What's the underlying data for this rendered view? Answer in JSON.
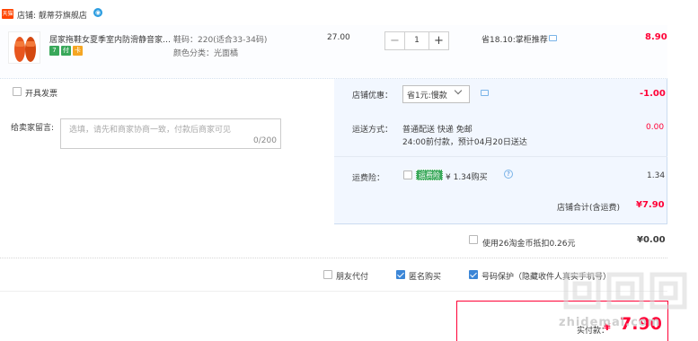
{
  "shop": {
    "tag": "天猫",
    "name": "店铺: 靓蒂芬旗舰店",
    "chat_icon": "wangwang-icon"
  },
  "item": {
    "title": "居家拖鞋女夏季室内防滑静音家…",
    "badges": [
      {
        "label": "7",
        "color": "#39a85a"
      },
      {
        "label": "付",
        "color": "#39a85a"
      },
      {
        "label": "卡",
        "color": "#f5a623"
      }
    ],
    "sku_size": "鞋码：220(适合33-34码)",
    "sku_color": "颜色分类：光面橘",
    "unit_price": "27.00",
    "quantity": "1",
    "saving": "省18.10:掌柜推荐",
    "subtotal": "8.90",
    "thumb_color": "#e8561e"
  },
  "invoice": {
    "label": "开具发票"
  },
  "message": {
    "label": "给卖家留言:",
    "placeholder": "选填，请先和商家协商一致，付款后商家可见",
    "counter": "0/200"
  },
  "coupon": {
    "label": "店铺优惠：",
    "selected": "省1元:慢款",
    "discount": "-1.00"
  },
  "shipping": {
    "label": "运送方式：",
    "line1": "普通配送 快递 免邮",
    "line2": "24:00前付款，预计04月20日送达",
    "fee": "0.00"
  },
  "insurance": {
    "label": "运费险：",
    "badge": "运费险",
    "text": "¥ 1.34购买",
    "fee": "1.34"
  },
  "shop_total": {
    "label": "店铺合计(含运费)",
    "value": "¥7.90"
  },
  "coins": {
    "label": "使用26淘金币抵扣0.26元",
    "value": "¥0.00"
  },
  "options": [
    {
      "label": "朋友代付",
      "checked": false
    },
    {
      "label": "匿名购买",
      "checked": true
    },
    {
      "label": "号码保护（隐藏收件人真实手机号）",
      "checked": true
    }
  ],
  "pay": {
    "label": "实付款：",
    "symbol": "¥",
    "value": "7.90"
  },
  "watermark": "zhidemai.com"
}
